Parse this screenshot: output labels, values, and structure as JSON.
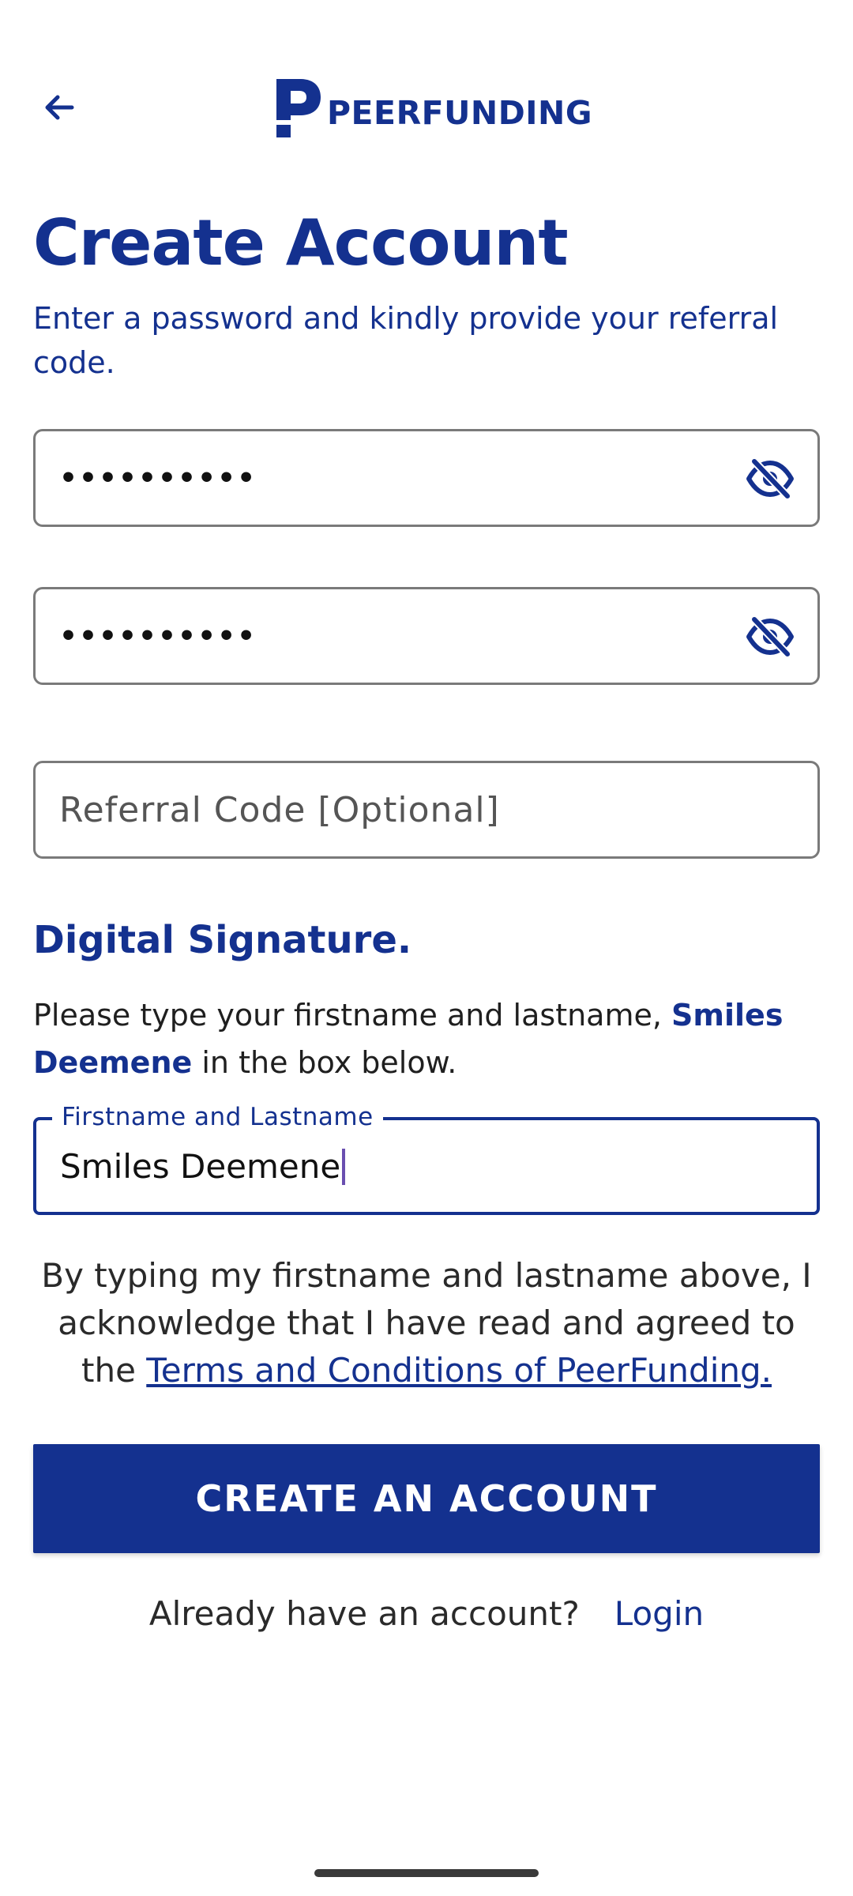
{
  "header": {
    "brand_name": "PEERFUNDING",
    "back_icon": "arrow-left-icon"
  },
  "page": {
    "title": "Create Account",
    "subtitle": "Enter a password and kindly provide your referral code."
  },
  "form": {
    "password": {
      "masked_value": "••••••••••",
      "toggle_icon": "eye-off-icon"
    },
    "confirm_password": {
      "masked_value": "••••••••••",
      "toggle_icon": "eye-off-icon"
    },
    "referral_code": {
      "placeholder": "Referral Code [Optional]",
      "value": ""
    }
  },
  "signature": {
    "section_title": "Digital Signature.",
    "instruction_prefix": "Please type your firstname and lastname, ",
    "instruction_name": "Smiles Deemene",
    "instruction_suffix": " in the box below.",
    "field_label": "Firstname and Lastname",
    "field_value": "Smiles Deemene"
  },
  "terms": {
    "text": "By typing my firstname and lastname above, I acknowledge that I have read and agreed to the ",
    "link_text": "Terms and Conditions of PeerFunding."
  },
  "actions": {
    "create_label": "CREATE AN ACCOUNT",
    "login_prompt": "Already have an account?",
    "login_link": "Login"
  },
  "colors": {
    "brand": "#14318f",
    "text": "#1f1f1f",
    "border": "#7a7a7a",
    "caret": "#6a4fb0"
  }
}
